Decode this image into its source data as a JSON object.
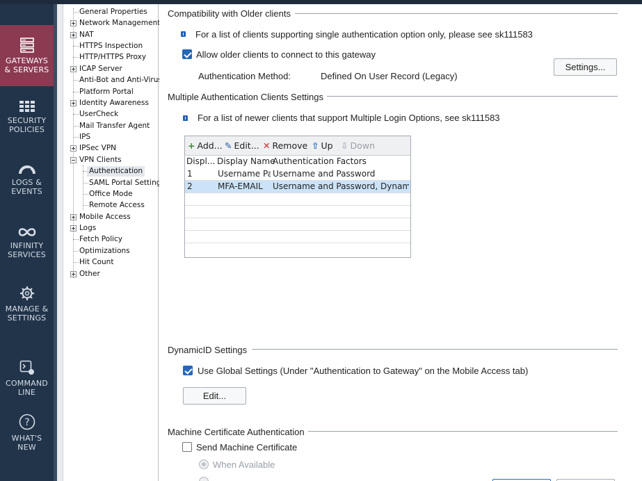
{
  "nav": {
    "items": [
      {
        "label": "GATEWAYS\n& SERVERS",
        "icon": "gateways-servers-icon",
        "active": true
      },
      {
        "label": "SECURITY\nPOLICIES",
        "icon": "security-policies-icon"
      },
      {
        "label": "LOGS &\nEVENTS",
        "icon": "logs-events-icon"
      },
      {
        "label": "INFINITY\nSERVICES",
        "icon": "infinity-icon"
      },
      {
        "label": "MANAGE &\nSETTINGS",
        "icon": "gear-icon"
      },
      {
        "label": "COMMAND\nLINE",
        "icon": "command-line-icon"
      },
      {
        "label": "WHAT'S\nNEW",
        "icon": "question-icon"
      }
    ]
  },
  "tree": {
    "items": [
      {
        "label": "General Properties"
      },
      {
        "label": "Network Management"
      },
      {
        "label": "NAT"
      },
      {
        "label": "HTTPS Inspection"
      },
      {
        "label": "HTTP/HTTPS Proxy"
      },
      {
        "label": "ICAP Server"
      },
      {
        "label": "Anti-Bot and Anti-Virus"
      },
      {
        "label": "Platform Portal"
      },
      {
        "label": "Identity Awareness"
      },
      {
        "label": "UserCheck"
      },
      {
        "label": "Mail Transfer Agent"
      },
      {
        "label": "IPS"
      },
      {
        "label": "IPSec VPN"
      },
      {
        "label": "VPN Clients"
      },
      {
        "label": "Authentication"
      },
      {
        "label": "SAML Portal Settings"
      },
      {
        "label": "Office Mode"
      },
      {
        "label": "Remote Access"
      },
      {
        "label": "Mobile Access"
      },
      {
        "label": "Logs"
      },
      {
        "label": "Fetch Policy"
      },
      {
        "label": "Optimizations"
      },
      {
        "label": "Hit Count"
      },
      {
        "label": "Other"
      }
    ],
    "selected": "Authentication"
  },
  "compat": {
    "title": "Compatibility with Older clients",
    "info": "For a list of clients supporting single authentication option only, please see sk111583",
    "allow_label": "Allow older clients to connect to this gateway",
    "allow_checked": true,
    "auth_method_label": "Authentication Method:",
    "auth_method_value": "Defined On User Record (Legacy)",
    "settings_button": "Settings..."
  },
  "multi": {
    "title": "Multiple Authentication Clients Settings",
    "info": "For a list of newer clients that support Multiple Login Options, see sk111583",
    "toolbar": {
      "add": "Add...",
      "edit": "Edit...",
      "remove": "Remove",
      "up": "Up",
      "down": "Down"
    },
    "columns": [
      "Displ...",
      "Display Name",
      "Authentication Factors"
    ],
    "rows": [
      {
        "order": "1",
        "name": "Username Pa",
        "factors": "Username and Password"
      },
      {
        "order": "2",
        "name": "MFA-EMAIL",
        "factors": "Username  and  Password, DynamicI"
      }
    ]
  },
  "dynamicid": {
    "title": "DynamicID Settings",
    "use_global_label": "Use Global Settings (Under \"Authentication to Gateway\" on the Mobile Access tab)",
    "use_global_checked": true,
    "edit_button": "Edit..."
  },
  "machine_cert": {
    "title": "Machine Certificate Authentication",
    "send_label": "Send Machine Certificate",
    "send_checked": false,
    "when_available": "When Available"
  },
  "colors": {
    "nav_bg": "#22344a",
    "nav_active": "#8b3a52",
    "checkbox": "#2468b7",
    "selected_row": "#cce3f7"
  }
}
